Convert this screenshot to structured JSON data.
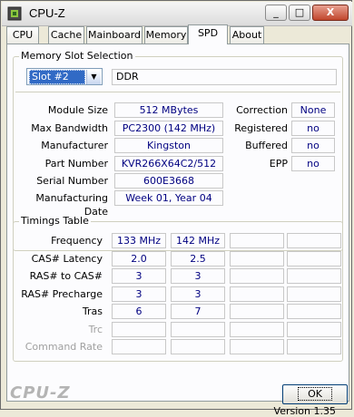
{
  "window": {
    "title": "CPU-Z",
    "minimize": "_",
    "maximize": "□",
    "close": "X"
  },
  "tabs": [
    {
      "label": "CPU"
    },
    {
      "label": "Cache"
    },
    {
      "label": "Mainboard"
    },
    {
      "label": "Memory"
    },
    {
      "label": "SPD"
    },
    {
      "label": "About"
    }
  ],
  "active_tab": "SPD",
  "slot": {
    "title": "Memory Slot Selection",
    "selected": "Slot #2",
    "type": "DDR"
  },
  "module": {
    "size_label": "Module Size",
    "size": "512 MBytes",
    "bandwidth_label": "Max Bandwidth",
    "bandwidth": "PC2300 (142 MHz)",
    "manufacturer_label": "Manufacturer",
    "manufacturer": "Kingston",
    "part_label": "Part Number",
    "part": "KVR266X64C2/512",
    "serial_label": "Serial Number",
    "serial": "600E3668",
    "date_label": "Manufacturing Date",
    "date": "Week 01, Year 04",
    "correction_label": "Correction",
    "correction": "None",
    "registered_label": "Registered",
    "registered": "no",
    "buffered_label": "Buffered",
    "buffered": "no",
    "epp_label": "EPP",
    "epp": "no"
  },
  "timings": {
    "title": "Timings Table",
    "rows": [
      {
        "label": "Frequency",
        "values": [
          "133 MHz",
          "142 MHz",
          "",
          ""
        ],
        "disabled": false
      },
      {
        "label": "CAS# Latency",
        "values": [
          "2.0",
          "2.5",
          "",
          ""
        ],
        "disabled": false
      },
      {
        "label": "RAS# to CAS#",
        "values": [
          "3",
          "3",
          "",
          ""
        ],
        "disabled": false
      },
      {
        "label": "RAS# Precharge",
        "values": [
          "3",
          "3",
          "",
          ""
        ],
        "disabled": false
      },
      {
        "label": "Tras",
        "values": [
          "6",
          "7",
          "",
          ""
        ],
        "disabled": false
      },
      {
        "label": "Trc",
        "values": [
          "",
          "",
          "",
          ""
        ],
        "disabled": true
      },
      {
        "label": "Command Rate",
        "values": [
          "",
          "",
          "",
          ""
        ],
        "disabled": true
      }
    ]
  },
  "footer": {
    "version": "Version 1.35",
    "brand": "CPU-Z",
    "ok_label": "OK"
  }
}
